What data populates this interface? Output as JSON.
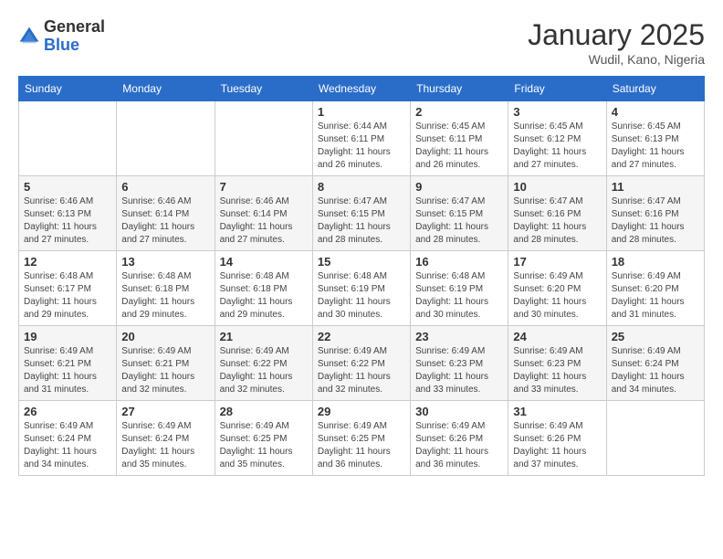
{
  "header": {
    "logo_general": "General",
    "logo_blue": "Blue",
    "month_title": "January 2025",
    "location": "Wudil, Kano, Nigeria"
  },
  "days_of_week": [
    "Sunday",
    "Monday",
    "Tuesday",
    "Wednesday",
    "Thursday",
    "Friday",
    "Saturday"
  ],
  "weeks": [
    [
      {
        "day": "",
        "info": ""
      },
      {
        "day": "",
        "info": ""
      },
      {
        "day": "",
        "info": ""
      },
      {
        "day": "1",
        "info": "Sunrise: 6:44 AM\nSunset: 6:11 PM\nDaylight: 11 hours and 26 minutes."
      },
      {
        "day": "2",
        "info": "Sunrise: 6:45 AM\nSunset: 6:11 PM\nDaylight: 11 hours and 26 minutes."
      },
      {
        "day": "3",
        "info": "Sunrise: 6:45 AM\nSunset: 6:12 PM\nDaylight: 11 hours and 27 minutes."
      },
      {
        "day": "4",
        "info": "Sunrise: 6:45 AM\nSunset: 6:13 PM\nDaylight: 11 hours and 27 minutes."
      }
    ],
    [
      {
        "day": "5",
        "info": "Sunrise: 6:46 AM\nSunset: 6:13 PM\nDaylight: 11 hours and 27 minutes."
      },
      {
        "day": "6",
        "info": "Sunrise: 6:46 AM\nSunset: 6:14 PM\nDaylight: 11 hours and 27 minutes."
      },
      {
        "day": "7",
        "info": "Sunrise: 6:46 AM\nSunset: 6:14 PM\nDaylight: 11 hours and 27 minutes."
      },
      {
        "day": "8",
        "info": "Sunrise: 6:47 AM\nSunset: 6:15 PM\nDaylight: 11 hours and 28 minutes."
      },
      {
        "day": "9",
        "info": "Sunrise: 6:47 AM\nSunset: 6:15 PM\nDaylight: 11 hours and 28 minutes."
      },
      {
        "day": "10",
        "info": "Sunrise: 6:47 AM\nSunset: 6:16 PM\nDaylight: 11 hours and 28 minutes."
      },
      {
        "day": "11",
        "info": "Sunrise: 6:47 AM\nSunset: 6:16 PM\nDaylight: 11 hours and 28 minutes."
      }
    ],
    [
      {
        "day": "12",
        "info": "Sunrise: 6:48 AM\nSunset: 6:17 PM\nDaylight: 11 hours and 29 minutes."
      },
      {
        "day": "13",
        "info": "Sunrise: 6:48 AM\nSunset: 6:18 PM\nDaylight: 11 hours and 29 minutes."
      },
      {
        "day": "14",
        "info": "Sunrise: 6:48 AM\nSunset: 6:18 PM\nDaylight: 11 hours and 29 minutes."
      },
      {
        "day": "15",
        "info": "Sunrise: 6:48 AM\nSunset: 6:19 PM\nDaylight: 11 hours and 30 minutes."
      },
      {
        "day": "16",
        "info": "Sunrise: 6:48 AM\nSunset: 6:19 PM\nDaylight: 11 hours and 30 minutes."
      },
      {
        "day": "17",
        "info": "Sunrise: 6:49 AM\nSunset: 6:20 PM\nDaylight: 11 hours and 30 minutes."
      },
      {
        "day": "18",
        "info": "Sunrise: 6:49 AM\nSunset: 6:20 PM\nDaylight: 11 hours and 31 minutes."
      }
    ],
    [
      {
        "day": "19",
        "info": "Sunrise: 6:49 AM\nSunset: 6:21 PM\nDaylight: 11 hours and 31 minutes."
      },
      {
        "day": "20",
        "info": "Sunrise: 6:49 AM\nSunset: 6:21 PM\nDaylight: 11 hours and 32 minutes."
      },
      {
        "day": "21",
        "info": "Sunrise: 6:49 AM\nSunset: 6:22 PM\nDaylight: 11 hours and 32 minutes."
      },
      {
        "day": "22",
        "info": "Sunrise: 6:49 AM\nSunset: 6:22 PM\nDaylight: 11 hours and 32 minutes."
      },
      {
        "day": "23",
        "info": "Sunrise: 6:49 AM\nSunset: 6:23 PM\nDaylight: 11 hours and 33 minutes."
      },
      {
        "day": "24",
        "info": "Sunrise: 6:49 AM\nSunset: 6:23 PM\nDaylight: 11 hours and 33 minutes."
      },
      {
        "day": "25",
        "info": "Sunrise: 6:49 AM\nSunset: 6:24 PM\nDaylight: 11 hours and 34 minutes."
      }
    ],
    [
      {
        "day": "26",
        "info": "Sunrise: 6:49 AM\nSunset: 6:24 PM\nDaylight: 11 hours and 34 minutes."
      },
      {
        "day": "27",
        "info": "Sunrise: 6:49 AM\nSunset: 6:24 PM\nDaylight: 11 hours and 35 minutes."
      },
      {
        "day": "28",
        "info": "Sunrise: 6:49 AM\nSunset: 6:25 PM\nDaylight: 11 hours and 35 minutes."
      },
      {
        "day": "29",
        "info": "Sunrise: 6:49 AM\nSunset: 6:25 PM\nDaylight: 11 hours and 36 minutes."
      },
      {
        "day": "30",
        "info": "Sunrise: 6:49 AM\nSunset: 6:26 PM\nDaylight: 11 hours and 36 minutes."
      },
      {
        "day": "31",
        "info": "Sunrise: 6:49 AM\nSunset: 6:26 PM\nDaylight: 11 hours and 37 minutes."
      },
      {
        "day": "",
        "info": ""
      }
    ]
  ]
}
